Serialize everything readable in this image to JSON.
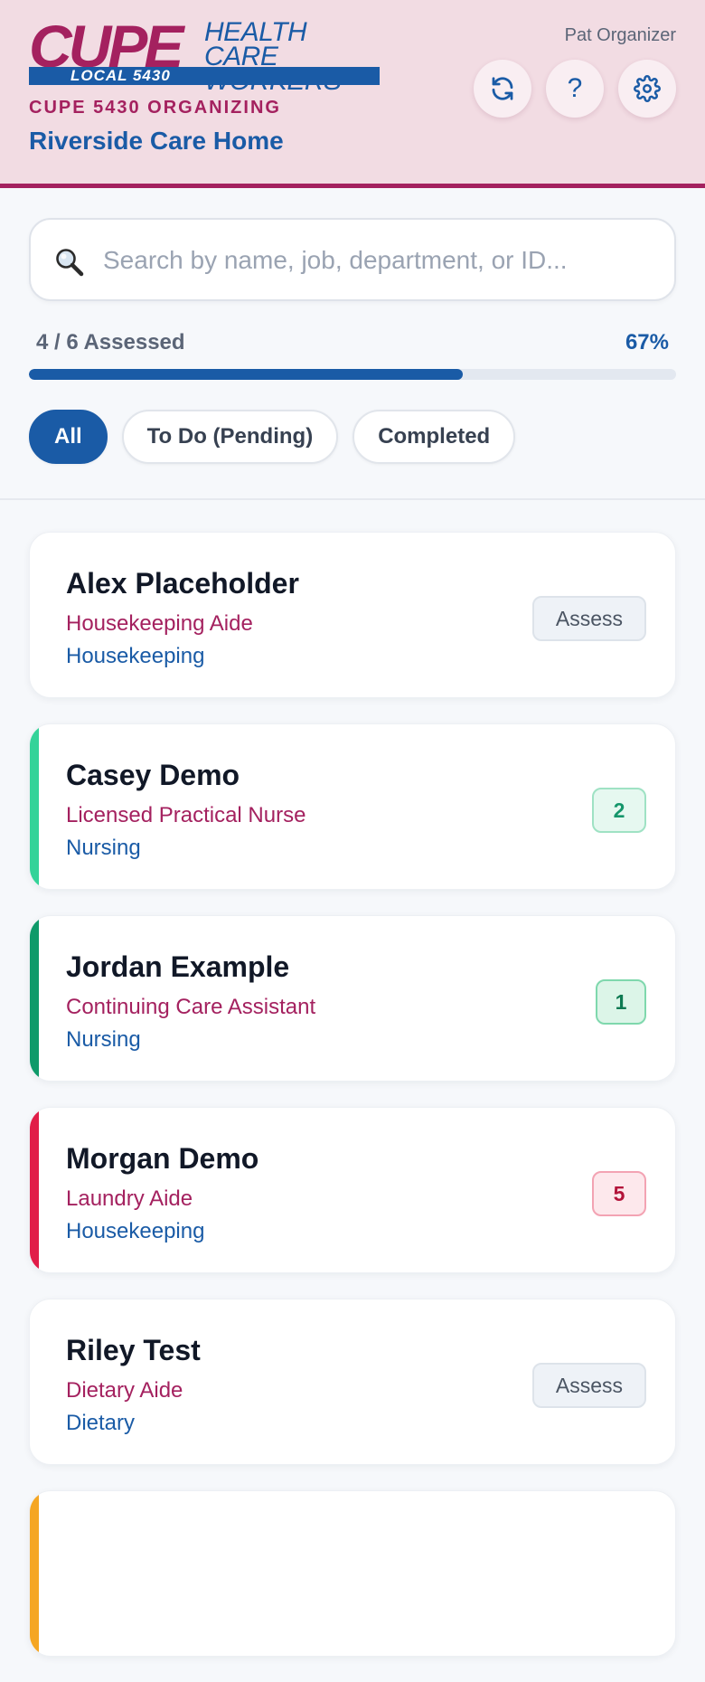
{
  "header": {
    "logo_main": "CUPE",
    "logo_sub": "HEALTH CARE\nWORKERS",
    "logo_local": "LOCAL 5430",
    "org_line": "CUPE 5430 ORGANIZING",
    "site_name": "Riverside Care Home",
    "user_name": "Pat Organizer",
    "help_label": "?",
    "accent_color": "#a4215f",
    "brand_color": "#1a5ba6",
    "icons": [
      "refresh-icon",
      "help-icon",
      "gear-icon"
    ]
  },
  "search": {
    "placeholder": "Search by name, job, department, or ID...",
    "value": ""
  },
  "progress": {
    "label": "4 / 6 Assessed",
    "percent_label": "67%",
    "fraction": 0.67
  },
  "filters": [
    {
      "label": "All",
      "active": true
    },
    {
      "label": "To Do (Pending)",
      "active": false
    },
    {
      "label": "Completed",
      "active": false
    }
  ],
  "workers": [
    {
      "name": "Alex Placeholder",
      "job": "Housekeeping Aide",
      "department": "Housekeeping",
      "status": "pending",
      "action_label": "Assess"
    },
    {
      "name": "Casey Demo",
      "job": "Licensed Practical Nurse",
      "department": "Nursing",
      "status": "assessed",
      "score": "2",
      "accent": "#34d399"
    },
    {
      "name": "Jordan Example",
      "job": "Continuing Care Assistant",
      "department": "Nursing",
      "status": "assessed",
      "score": "1",
      "accent": "#0f9a6a"
    },
    {
      "name": "Morgan Demo",
      "job": "Laundry Aide",
      "department": "Housekeeping",
      "status": "assessed",
      "score": "5",
      "accent": "#e11d48"
    },
    {
      "name": "Riley Test",
      "job": "Dietary Aide",
      "department": "Dietary",
      "status": "pending",
      "action_label": "Assess"
    }
  ]
}
